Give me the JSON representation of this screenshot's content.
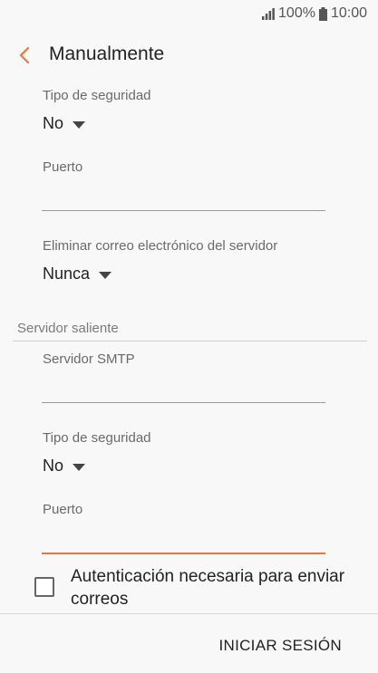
{
  "status_bar": {
    "battery": "100%",
    "time": "10:00"
  },
  "app_bar": {
    "title": "Manualmente"
  },
  "incoming": {
    "security_label": "Tipo de seguridad",
    "security_value": "No",
    "port_label": "Puerto",
    "port_value": "",
    "delete_label": "Eliminar correo electrónico del servidor",
    "delete_value": "Nunca"
  },
  "outgoing": {
    "section_title": "Servidor saliente",
    "smtp_label": "Servidor SMTP",
    "smtp_value": "",
    "security_label": "Tipo de seguridad",
    "security_value": "No",
    "port_label": "Puerto",
    "port_value": ""
  },
  "auth_checkbox": {
    "label": "Autenticación necesaria para enviar correos",
    "checked": false
  },
  "actions": {
    "signin_label": "INICIAR SESIÓN"
  },
  "colors": {
    "accent": "#e8763f",
    "text": "#222222",
    "label": "#6a6a6a"
  },
  "icons": [
    "signal-icon",
    "battery-icon",
    "back-chevron-icon",
    "dropdown-caret-icon",
    "checkbox-icon"
  ]
}
